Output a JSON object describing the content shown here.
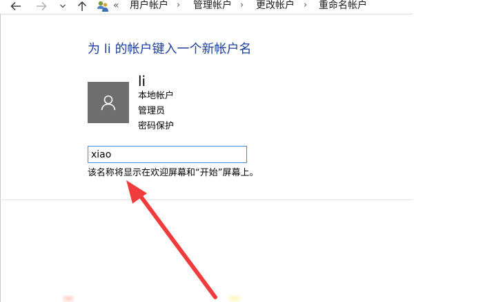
{
  "address_bar": {
    "overflow_glyph": "«",
    "separator_glyph": "›",
    "breadcrumbs": [
      "用户帐户",
      "管理帐户",
      "更改帐户",
      "重命名帐户"
    ]
  },
  "icons": {
    "back": "arrow-left-icon",
    "forward": "arrow-right-icon",
    "recent": "chevron-down-icon",
    "up": "arrow-up-icon",
    "location": "user-accounts-icon",
    "avatar": "user-silhouette-icon"
  },
  "content": {
    "heading": "为 li 的帐户键入一个新帐户名",
    "account": {
      "name": "li",
      "type": "本地帐户",
      "role": "管理员",
      "security": "密码保护"
    },
    "new_name_value": "xiao",
    "hint": "该名称将显示在欢迎屏幕和“开始”屏幕上。"
  },
  "colors": {
    "heading": "#1e3e9e",
    "avatar_bg": "#6e6e6e",
    "input_border": "#3c8ddb",
    "annotation_arrow": "#f03c3c"
  }
}
